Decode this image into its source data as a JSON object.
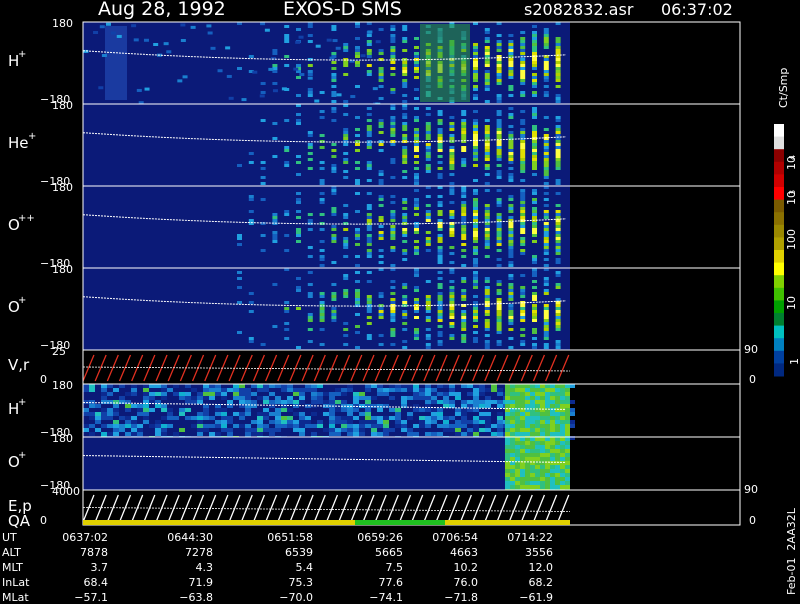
{
  "header": {
    "date": "Aug 28, 1992",
    "instrument": "EXOS-D SMS",
    "file": "s2082832.asr",
    "time": "06:37:02"
  },
  "panels": [
    {
      "label_base": "H",
      "label_sup": "+",
      "top_tick": "180",
      "bottom_tick": "−180",
      "kind": "spectrogram"
    },
    {
      "label_base": "He",
      "label_sup": "+",
      "top_tick": "180",
      "bottom_tick": "−180",
      "kind": "spectrogram"
    },
    {
      "label_base": "O",
      "label_sup": "++",
      "top_tick": "180",
      "bottom_tick": "−180",
      "kind": "spectrogram"
    },
    {
      "label_base": "O",
      "label_sup": "+",
      "top_tick": "180",
      "bottom_tick": "−180",
      "kind": "spectrogram"
    },
    {
      "label_base": "V,r",
      "label_sup": "",
      "top_tick": "25",
      "bottom_tick": "0",
      "right_top_tick": "90",
      "right_bottom_tick": "0",
      "kind": "line"
    },
    {
      "label_base": "H",
      "label_sup": "+",
      "top_tick": "180",
      "bottom_tick": "−180",
      "kind": "spectrogram2"
    },
    {
      "label_base": "O",
      "label_sup": "+",
      "top_tick": "180",
      "bottom_tick": "−180",
      "kind": "spectrogram3"
    },
    {
      "label_base": "E,p",
      "label_sup": "",
      "label_line2": "QA",
      "top_tick": "4000",
      "bottom_tick": "0",
      "right_top_tick": "90",
      "right_bottom_tick": "0",
      "kind": "line2"
    }
  ],
  "colorbar": {
    "units": "Ct/Smp",
    "tick_labels": [
      "10",
      "4",
      "10",
      "3",
      "100",
      "10",
      "1"
    ],
    "colors": [
      "#ffffff",
      "#e0e0e0",
      "#8b0000",
      "#b00000",
      "#d00000",
      "#ff0000",
      "#7a5a00",
      "#8a7000",
      "#9a8800",
      "#b0a000",
      "#e0d000",
      "#ffff00",
      "#80d000",
      "#40c000",
      "#00a000",
      "#008030",
      "#00c0c0",
      "#0080c0",
      "#0040a0",
      "#002880"
    ]
  },
  "ephemeris": {
    "labels": [
      "UT",
      "ALT",
      "MLT",
      "InLat",
      "MLat"
    ],
    "columns": [
      [
        "0637:02",
        "7878",
        "3.7",
        "68.4",
        "−57.1"
      ],
      [
        "0644:30",
        "7278",
        "4.3",
        "71.9",
        "−63.8"
      ],
      [
        "0651:58",
        "6539",
        "5.4",
        "75.3",
        "−70.0"
      ],
      [
        "0659:26",
        "5665",
        "7.5",
        "77.6",
        "−74.1"
      ],
      [
        "0706:54",
        "4663",
        "10.2",
        "76.0",
        "−71.8"
      ],
      [
        "0714:22",
        "3556",
        "12.0",
        "68.2",
        "−61.9"
      ]
    ]
  },
  "footer_code": "Feb-01  2AA32L",
  "chart_data": {
    "type": "heatmap",
    "title": "Aug 28, 1992   EXOS-D SMS",
    "x_ticks": [
      "0637:02",
      "0644:30",
      "0651:58",
      "0659:26",
      "0706:54",
      "0714:22"
    ],
    "y_range_pitch": [
      -180,
      180
    ],
    "colorbar_range": [
      1,
      10000
    ],
    "colorbar_scale": "log",
    "grid": false
  }
}
